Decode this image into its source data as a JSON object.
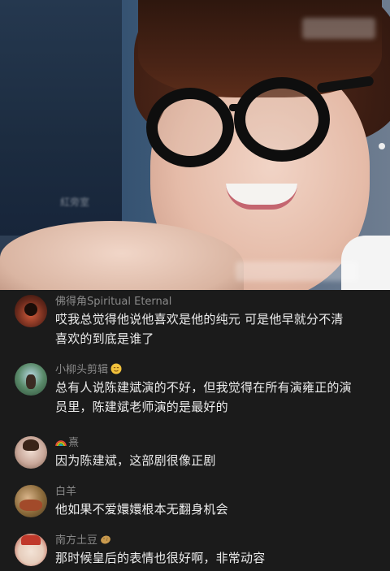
{
  "video": {
    "watermark_top": "",
    "watermark_left": "紅旁室"
  },
  "comments": [
    {
      "username": "佛得角Spiritual Eternal",
      "text_lines": [
        "哎我总觉得他说他喜欢是他的纯元 可是他早就分不清",
        "喜欢的到底是谁了"
      ],
      "avatar_color": "#6a2a1c"
    },
    {
      "username": "小柳头剪辑",
      "username_emoji": "smiling-face-icon",
      "text_lines": [
        "总有人说陈建斌演的不好，但我觉得在所有演雍正的演",
        "员里，陈建斌老师演的是最好的"
      ],
      "avatar_color": "#3b6e4a"
    },
    {
      "username_prefix_icon": "rainbow-icon",
      "username": "熹",
      "text_lines": [
        "因为陈建斌，这部剧很像正剧"
      ],
      "avatar_color": "#c9a89a"
    },
    {
      "username": "白羊",
      "text_lines": [
        "他如果不爱嬛嬛根本无翻身机会"
      ],
      "avatar_color": "#8b6a3a"
    },
    {
      "username": "南方土豆",
      "username_emoji": "potato-icon",
      "text_lines": [
        "那时候皇后的表情也很好啊，非常动容"
      ],
      "avatar_color": "#b53a2a"
    }
  ]
}
